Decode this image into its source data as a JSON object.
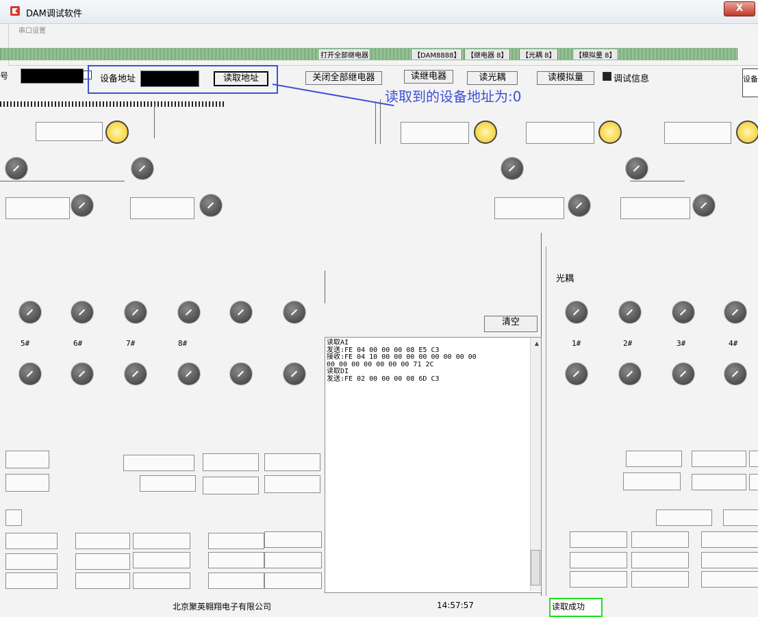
{
  "window": {
    "title": "DAM调试软件",
    "close_label": "X"
  },
  "group": {
    "legend": "串口设置"
  },
  "artifact_tabs": [
    "【DAM8888】",
    "【继电器 8】",
    "【光耦 8】",
    "【模拟量 8】",
    "打开全部继电器"
  ],
  "toolbar": {
    "port_label": "号",
    "device_addr_label": "设备地址",
    "read_addr_button": "读取地址",
    "close_all_relays_button": "关闭全部继电器",
    "read_relay_button": "读继电器",
    "read_optocoupler_button": "读光耦",
    "read_analog_button": "读模拟量",
    "debug_info_label": "调试信息",
    "right_cut_label": "设备"
  },
  "hint": "读取到的设备地址为:0",
  "optocoupler_panel": {
    "title": "光耦",
    "labels": [
      "1#",
      "2#",
      "3#",
      "4#"
    ]
  },
  "left_panel": {
    "labels": [
      "5#",
      "6#",
      "7#",
      "8#"
    ]
  },
  "log": {
    "clear_button": "清空",
    "text": "读取AI\n发送:FE 04 00 00 00 08 E5 C3\n接收:FE 04 10 00 00 00 00 00 00 00 00\n00 00 00 00 00 00 00 71 2C\n读取DI\n发送:FE 02 00 00 00 08 6D C3"
  },
  "statusbar": {
    "company": "北京聚英翱翔电子有限公司",
    "time": "14:57:57",
    "status": "读取成功"
  },
  "colors": {
    "accent_blue": "#3c4fd6",
    "status_green": "#22dd22",
    "gauge_yellow": "#f2c418"
  }
}
